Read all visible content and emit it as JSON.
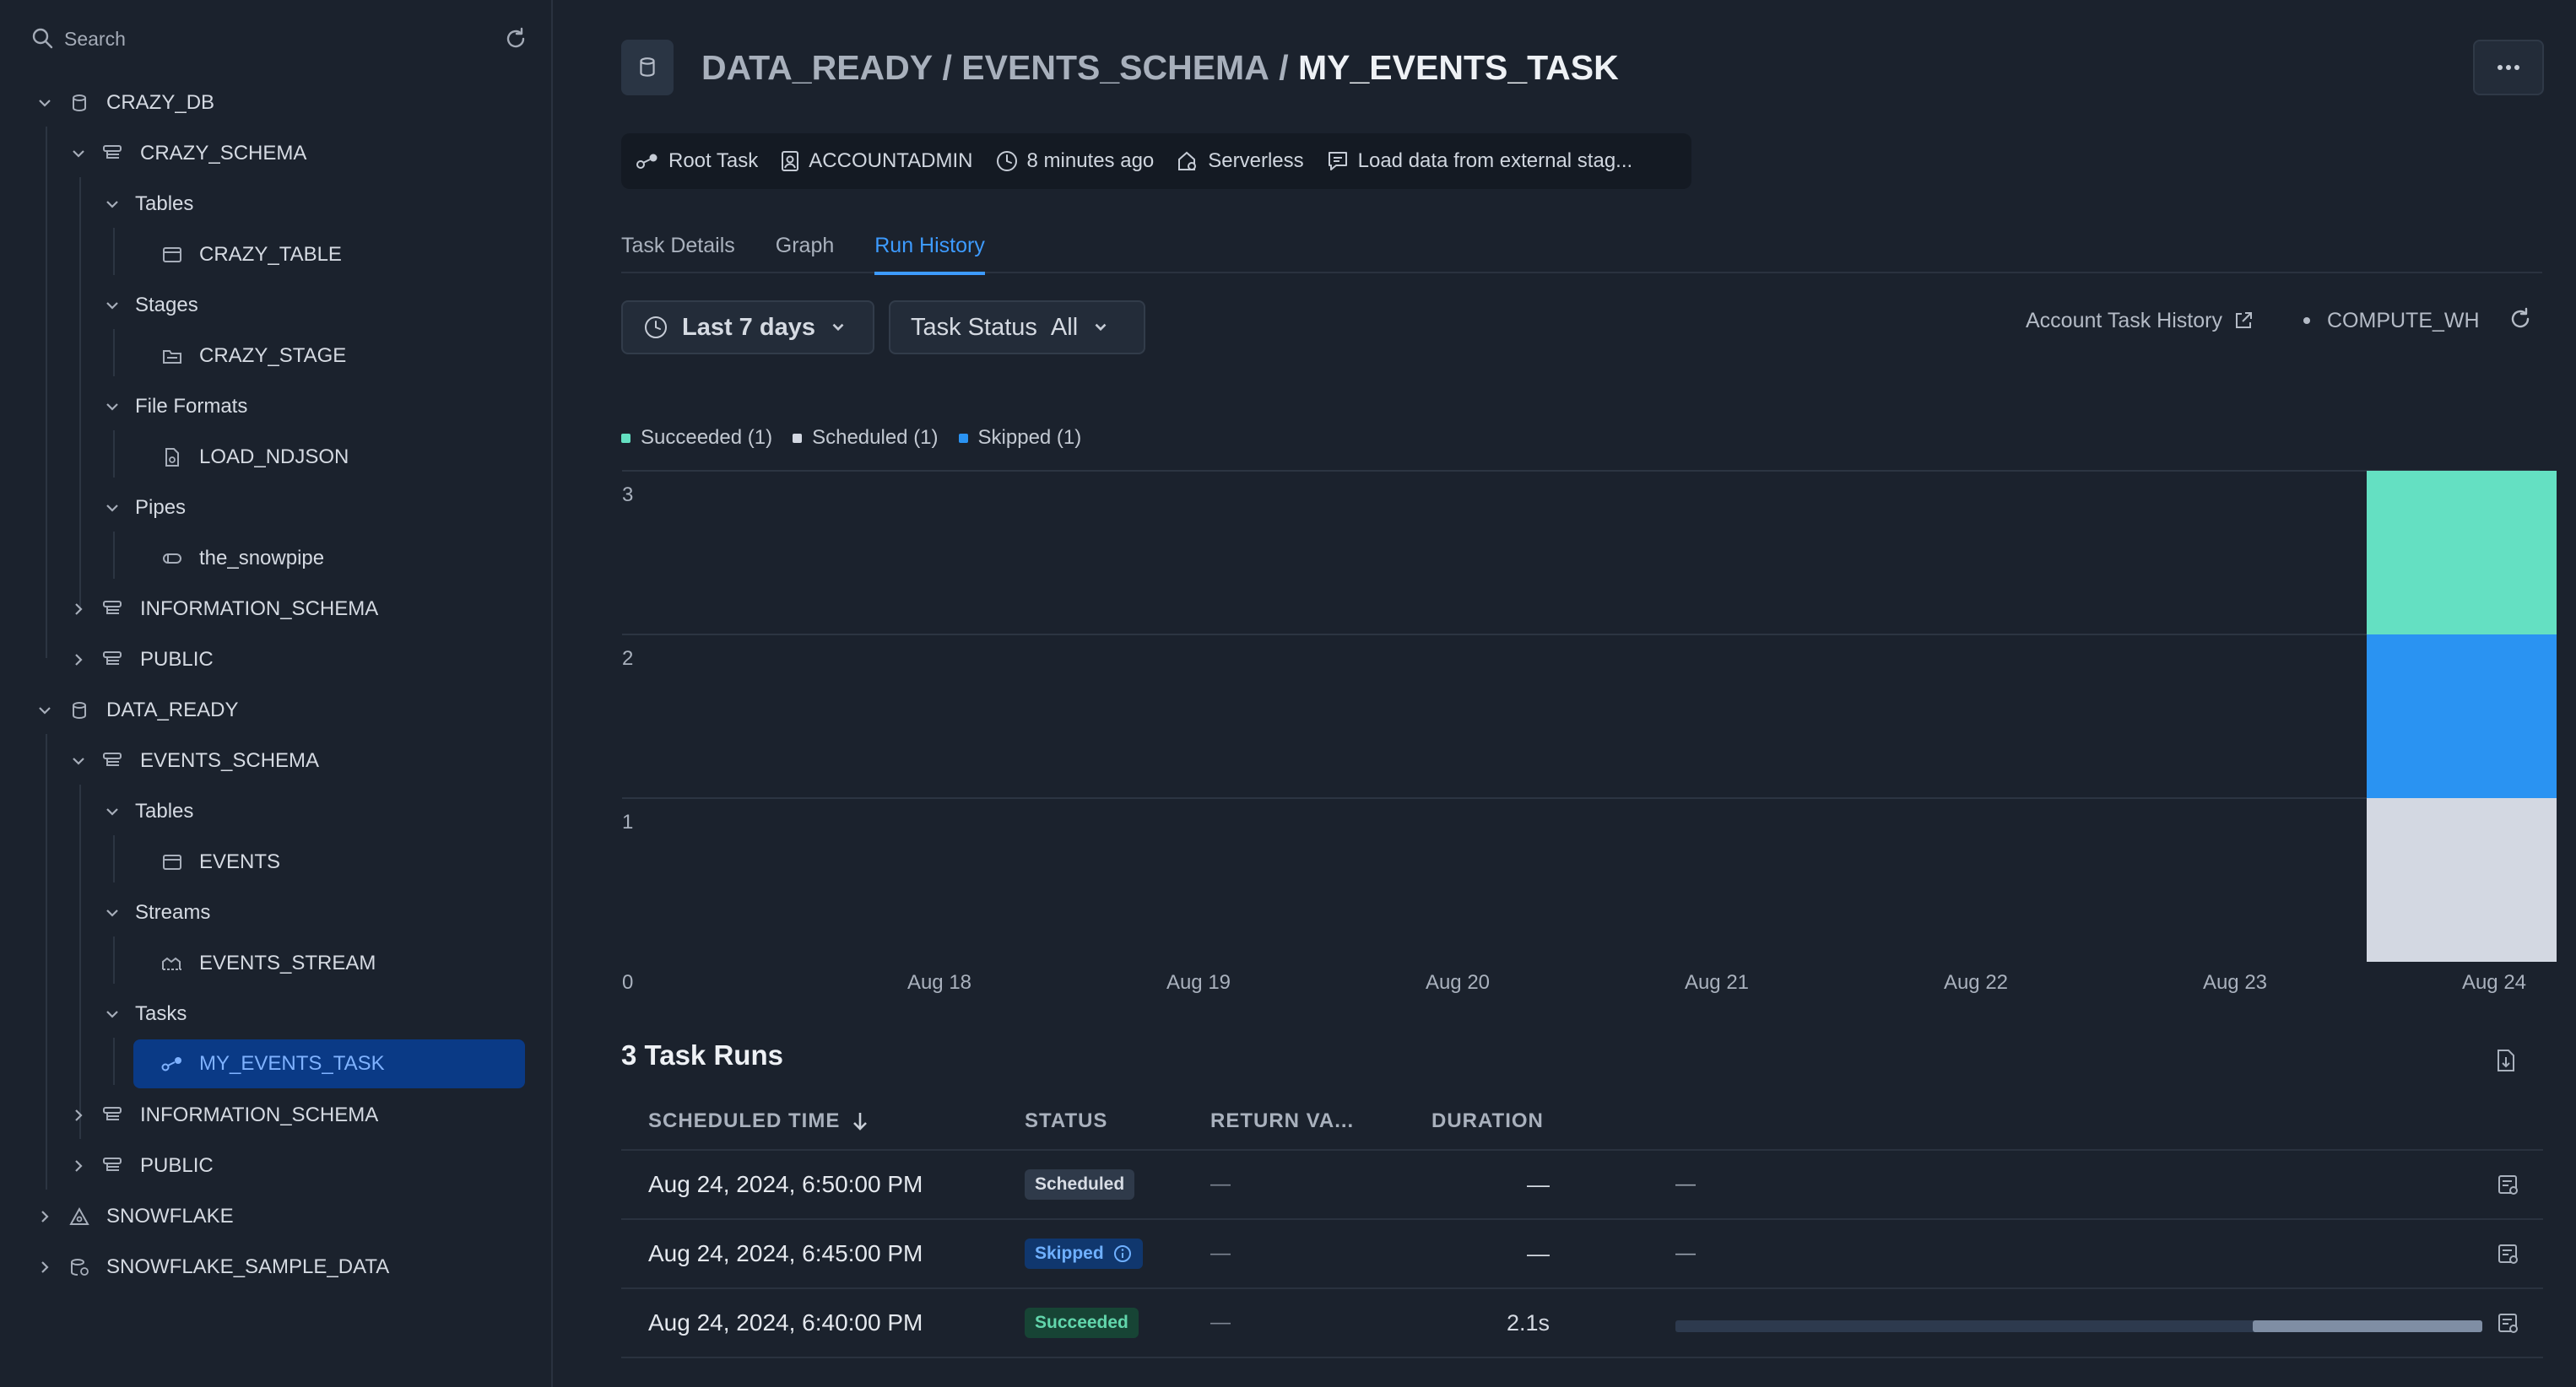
{
  "sidebar": {
    "search_placeholder": "Search",
    "items": [
      {
        "label": "CRAZY_DB"
      },
      {
        "label": "CRAZY_SCHEMA"
      },
      {
        "label": "Tables"
      },
      {
        "label": "CRAZY_TABLE"
      },
      {
        "label": "Stages"
      },
      {
        "label": "CRAZY_STAGE"
      },
      {
        "label": "File Formats"
      },
      {
        "label": "LOAD_NDJSON"
      },
      {
        "label": "Pipes"
      },
      {
        "label": "the_snowpipe"
      },
      {
        "label": "INFORMATION_SCHEMA"
      },
      {
        "label": "PUBLIC"
      },
      {
        "label": "DATA_READY"
      },
      {
        "label": "EVENTS_SCHEMA"
      },
      {
        "label": "Tables"
      },
      {
        "label": "EVENTS"
      },
      {
        "label": "Streams"
      },
      {
        "label": "EVENTS_STREAM"
      },
      {
        "label": "Tasks"
      },
      {
        "label": "MY_EVENTS_TASK"
      },
      {
        "label": "INFORMATION_SCHEMA"
      },
      {
        "label": "PUBLIC"
      },
      {
        "label": "SNOWFLAKE"
      },
      {
        "label": "SNOWFLAKE_SAMPLE_DATA"
      }
    ]
  },
  "header": {
    "db": "DATA_READY",
    "sep": " / ",
    "schema": "EVENTS_SCHEMA",
    "task": "MY_EVENTS_TASK"
  },
  "meta": {
    "type": "Root Task",
    "owner": "ACCOUNTADMIN",
    "updated": "8 minutes ago",
    "compute": "Serverless",
    "comment": "Load data from external stag..."
  },
  "tabs": [
    "Task Details",
    "Graph",
    "Run History"
  ],
  "filters": {
    "range": "Last 7 days",
    "status_label": "Task Status",
    "status_value": "All"
  },
  "toolbar": {
    "account_history": "Account Task History",
    "warehouse": "COMPUTE_WH"
  },
  "legend": [
    {
      "label": "Succeeded (1)",
      "color": "#64e0c2"
    },
    {
      "label": "Scheduled (1)",
      "color": "#d3d8e2"
    },
    {
      "label": "Skipped (1)",
      "color": "#2a93f2"
    }
  ],
  "chart_data": {
    "type": "bar",
    "stacked": true,
    "categories": [
      "Aug 18",
      "Aug 19",
      "Aug 20",
      "Aug 21",
      "Aug 22",
      "Aug 23",
      "Aug 24"
    ],
    "series": [
      {
        "name": "Scheduled",
        "color": "#d3d8e2",
        "values": [
          0,
          0,
          0,
          0,
          0,
          0,
          1
        ]
      },
      {
        "name": "Skipped",
        "color": "#2a93f2",
        "values": [
          0,
          0,
          0,
          0,
          0,
          0,
          1
        ]
      },
      {
        "name": "Succeeded",
        "color": "#64e0c2",
        "values": [
          0,
          0,
          0,
          0,
          0,
          0,
          1
        ]
      }
    ],
    "yticks": [
      "0",
      "1",
      "2",
      "3"
    ],
    "ylim": [
      0,
      3
    ],
    "grid": true
  },
  "runs": {
    "title": "3 Task Runs",
    "columns": [
      "SCHEDULED TIME",
      "STATUS",
      "RETURN VA...",
      "DURATION"
    ],
    "rows": [
      {
        "time": "Aug 24, 2024, 6:50:00 PM",
        "status": "Scheduled",
        "return": "—",
        "duration": "—",
        "timeline": "—"
      },
      {
        "time": "Aug 24, 2024, 6:45:00 PM",
        "status": "Skipped",
        "return": "—",
        "duration": "—",
        "timeline": "—"
      },
      {
        "time": "Aug 24, 2024, 6:40:00 PM",
        "status": "Succeeded",
        "return": "—",
        "duration": "2.1s",
        "timeline_fraction": 0.285
      }
    ]
  }
}
